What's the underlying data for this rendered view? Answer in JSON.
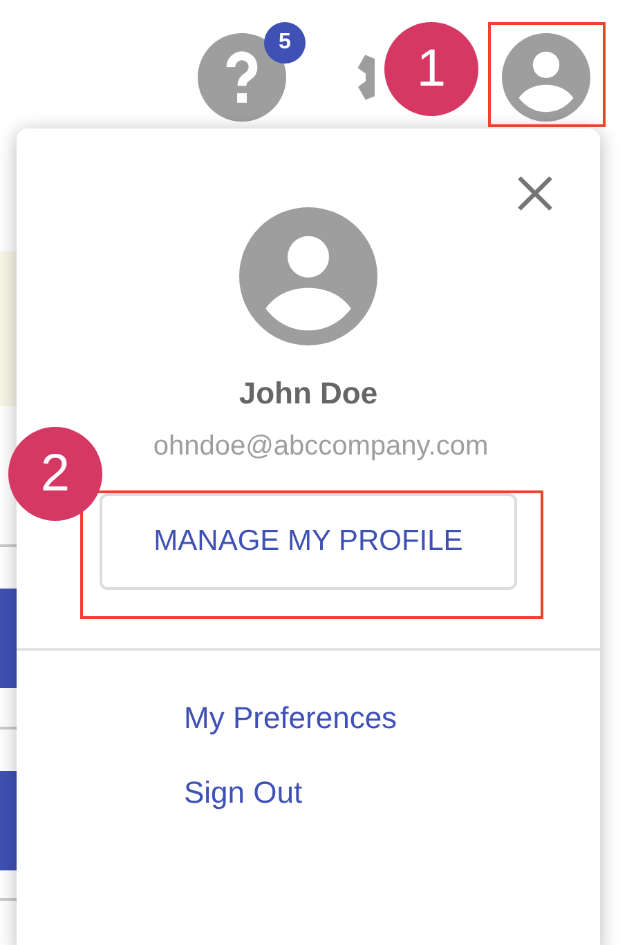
{
  "header": {
    "help_badge": "5"
  },
  "annotations": [
    {
      "label": "1"
    },
    {
      "label": "2"
    }
  ],
  "profile_menu": {
    "name": "John Doe",
    "email": "ohndoe@abccompany.com",
    "manage_button": "MANAGE MY PROFILE",
    "links": [
      {
        "label": "My Preferences"
      },
      {
        "label": "Sign Out"
      }
    ]
  }
}
